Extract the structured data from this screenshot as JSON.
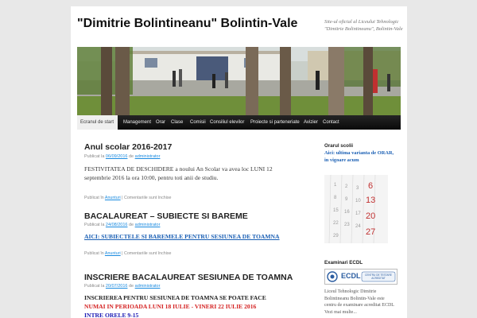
{
  "header": {
    "site_title": "\"Dimitrie Bolintineanu\" Bolintin-Vale",
    "site_description": "Site-ul oficial al Liceului Tehnologic \"Dimitrie Bolintineanu\", Bolintin-Vale"
  },
  "nav": {
    "items": [
      "Ecranul de start",
      "Management",
      "Orar",
      "Clase",
      "Comisii",
      "Consiliul elevilor",
      "Proiecte si parteneriate",
      "Avizier",
      "Contact"
    ]
  },
  "posts": [
    {
      "title": "Anul scolar 2016-2017",
      "meta_prefix": "Publicat la",
      "date": "06/09/2016",
      "meta_by": "de",
      "author": "administrator",
      "body": "FESTIVITATEA DE DESCHIDERE a noului An Scolar va avea loc LUNI 12 septembrie 2016 la ora 10:00, pentru toti anii de studiu.",
      "foot_prefix": "Publicat în",
      "category": "Anunturi",
      "foot_sep": "|",
      "comments": "Comentariile sunt închise"
    },
    {
      "title": "BACALAUREAT – SUBIECTE SI BAREME",
      "meta_prefix": "Publicat la",
      "date": "24/08/2016",
      "meta_by": "de",
      "author": "administrator",
      "link": "AICI: SUBIECTELE SI BAREMELE PENTRU SESIUNEA DE TOAMNA",
      "foot_prefix": "Publicat în",
      "category": "Anunturi",
      "foot_sep": "|",
      "comments": "Comentariile sunt închise"
    },
    {
      "title": "INSCRIERE BACALAUREAT SESIUNEA DE TOAMNA",
      "meta_prefix": "Publicat la",
      "date": "20/07/2016",
      "meta_by": "de",
      "author": "administrator",
      "line1": "INSCRIEREA PENTRU SESIUNEA DE TOAMNA SE POATE FACE",
      "line2": "NUMAI IN PERIOADA LUNI 18 IULIE - VINERI 22 IULIE 2016",
      "line3": "INTRE ORELE 9-15"
    }
  ],
  "sidebar": {
    "orar_heading": "Orarul scolii",
    "orar_link": "Aici: ultima varianta de ORAR, in vigoare acum",
    "calendar_numbers": [
      "6",
      "13",
      "20",
      "27"
    ],
    "ecdl_heading": "Examinari ECDL",
    "ecdl_logo_text": "ECDL",
    "ecdl_badge_text": "CENTRU DE TESTARE ACREDITAT",
    "ecdl_text": "Liceul Tehnologic Dimitrie Bolintineanu Bolintin-Vale este centru de examinare acreditat ECDL",
    "ecdl_more": "Vezi mai multe..."
  },
  "colors": {
    "link": "#1b8be0",
    "nav_bg": "#0a0a0a",
    "accent_red": "#d42020",
    "accent_blue": "#1a1ab4"
  }
}
